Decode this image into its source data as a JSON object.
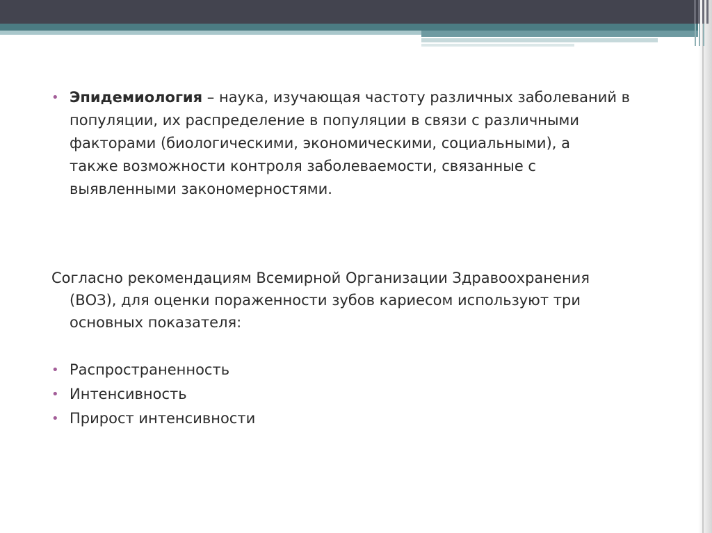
{
  "slide": {
    "definition": {
      "term": "Эпидемиология",
      "lines": [
        " – наука, изучающая частоту различных заболеваний в",
        "популяции, их распределение в популяции в связи с различными",
        "факторами (биологическими, экономическими, социальными), а",
        "также возможности контроля заболеваемости, связанные с",
        "выявленными закономерностями."
      ]
    },
    "who_paragraph": {
      "lines": [
        "Согласно рекомендациям Всемирной Организации Здравоохранения",
        "(ВОЗ), для оценки пораженности зубов кариесом используют три",
        "основных показателя:"
      ]
    },
    "indicators": [
      "Распространенность",
      "Интенсивность",
      "Прирост интенсивности"
    ],
    "bullet_glyph": "•"
  },
  "colors": {
    "header_dark": "#43444f",
    "header_teal": "#4b7b82",
    "bullet": "#a35d98",
    "text": "#2b2b2b"
  }
}
